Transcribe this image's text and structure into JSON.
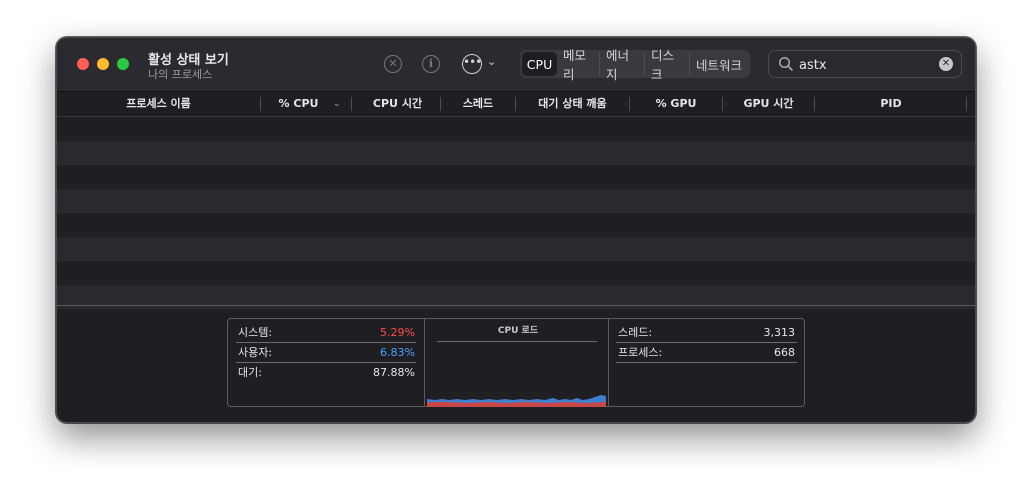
{
  "window": {
    "title": "활성 상태 보기",
    "subtitle": "나의 프로세스"
  },
  "toolbar": {
    "stop_icon": "stop-process-icon",
    "info_icon": "info-icon",
    "more_icon": "ellipsis-circle-icon",
    "tabs": [
      {
        "label": "CPU",
        "active": true
      },
      {
        "label": "메모리",
        "active": false
      },
      {
        "label": "에너지",
        "active": false
      },
      {
        "label": "디스크",
        "active": false
      },
      {
        "label": "네트워크",
        "active": false
      }
    ],
    "search": {
      "value": "astx",
      "placeholder": "검색"
    }
  },
  "columns": [
    {
      "label": "프로세스 이름"
    },
    {
      "label": "% CPU",
      "sorted": "descending"
    },
    {
      "label": "CPU 시간"
    },
    {
      "label": "스레드"
    },
    {
      "label": "대기 상태 깨움"
    },
    {
      "label": "% GPU"
    },
    {
      "label": "GPU 시간"
    },
    {
      "label": "PID"
    }
  ],
  "rows": [],
  "summary": {
    "left": [
      {
        "label": "시스템:",
        "value": "5.29%",
        "color": "#ff4d4d"
      },
      {
        "label": "사용자:",
        "value": "6.83%",
        "color": "#4aa3ff"
      },
      {
        "label": "대기:",
        "value": "87.88%",
        "color": "#e6e6ea"
      }
    ],
    "middle": {
      "title": "CPU 로드"
    },
    "right": [
      {
        "label": "스레드:",
        "value": "3,313"
      },
      {
        "label": "프로세스:",
        "value": "668"
      }
    ]
  },
  "colors": {
    "system": "#ff4d4d",
    "user": "#4aa3ff",
    "background": "#1f1e23"
  }
}
